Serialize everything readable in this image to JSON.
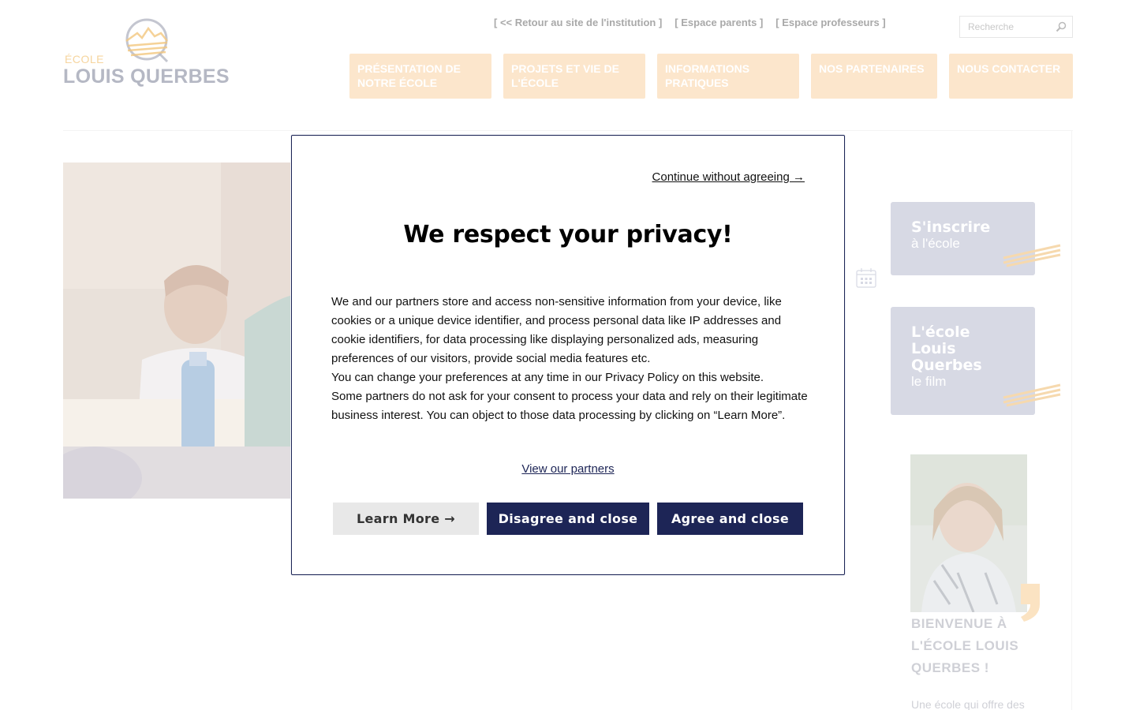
{
  "site": {
    "logo": {
      "small": "ÉCOLE",
      "big": "LOUIS QUERBES"
    },
    "toplinks": [
      "[ << Retour au site de l'institution ]",
      "[ Espace parents ]",
      "[ Espace professeurs ]"
    ],
    "search": {
      "placeholder": "Recherche"
    },
    "nav": [
      "PRÉSENTATION DE NOTRE ÉCOLE",
      "PROJETS ET VIE DE L'ÉCOLE",
      "INFORMATIONS PRATIQUES",
      "NOS PARTENAIRES",
      "NOUS CONTACTER"
    ],
    "cta": [
      {
        "title": "S'inscrire",
        "subtitle": "à l'école"
      },
      {
        "title": "L'école Louis Querbes",
        "subtitle": "le film"
      }
    ],
    "welcome": {
      "title": "BIENVENUE À L'ÉCOLE LOUIS QUERBES !",
      "text": "Une école qui offre des"
    },
    "colors": {
      "nav_bg": "#fce6cc",
      "cta_bg": "#d7d9e4",
      "accent": "#f3c77e"
    }
  },
  "consent": {
    "continue_link": "Continue without agreeing →",
    "title": "We respect your privacy!",
    "paragraphs": [
      "We and our partners store and access non-sensitive information from your device, like cookies or a unique device identifier, and process personal data like IP addresses and cookie identifiers, for data processing like displaying personalized ads, measuring preferences of our visitors, provide social media features etc.",
      "You can change your preferences at any time in our Privacy Policy on this website.",
      "Some partners do not ask for your consent to process your data and rely on their legitimate business interest. You can object to those data processing by clicking on “Learn More”."
    ],
    "view_partners": "View our partners",
    "buttons": {
      "learn_more": "Learn More →",
      "disagree": "Disagree and close",
      "agree": "Agree and close"
    },
    "colors": {
      "primary": "#1d2556",
      "secondary": "#e8e8e8"
    }
  }
}
